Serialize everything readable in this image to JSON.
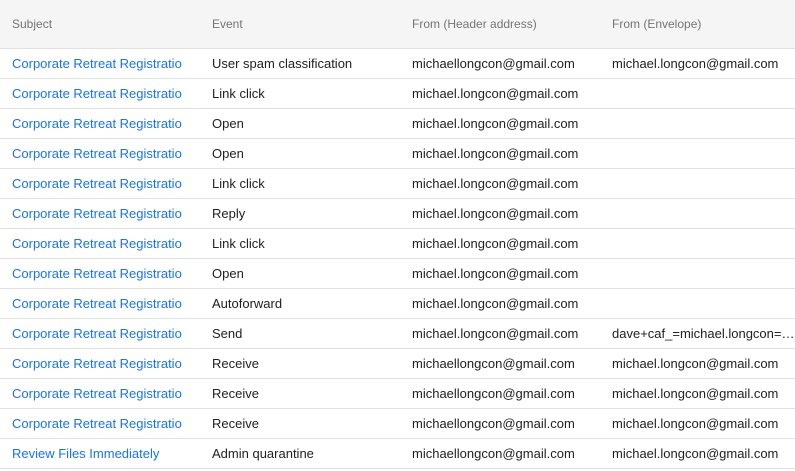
{
  "columns": {
    "subject": "Subject",
    "event": "Event",
    "from_header": "From (Header address)",
    "from_envelope": "From (Envelope)"
  },
  "rows": [
    {
      "subject": "Corporate Retreat Registratio",
      "event": "User spam classification",
      "from_header": "michaellongcon@gmail.com",
      "from_envelope": "michael.longcon@gmail.com"
    },
    {
      "subject": "Corporate Retreat Registratio",
      "event": "Link click",
      "from_header": "michael.longcon@gmail.com",
      "from_envelope": ""
    },
    {
      "subject": "Corporate Retreat Registratio",
      "event": "Open",
      "from_header": "michael.longcon@gmail.com",
      "from_envelope": ""
    },
    {
      "subject": "Corporate Retreat Registratio",
      "event": "Open",
      "from_header": "michael.longcon@gmail.com",
      "from_envelope": ""
    },
    {
      "subject": "Corporate Retreat Registratio",
      "event": "Link click",
      "from_header": "michael.longcon@gmail.com",
      "from_envelope": ""
    },
    {
      "subject": "Corporate Retreat Registratio",
      "event": "Reply",
      "from_header": "michael.longcon@gmail.com",
      "from_envelope": ""
    },
    {
      "subject": "Corporate Retreat Registratio",
      "event": "Link click",
      "from_header": "michael.longcon@gmail.com",
      "from_envelope": ""
    },
    {
      "subject": "Corporate Retreat Registratio",
      "event": "Open",
      "from_header": "michael.longcon@gmail.com",
      "from_envelope": ""
    },
    {
      "subject": "Corporate Retreat Registratio",
      "event": "Autoforward",
      "from_header": "michael.longcon@gmail.com",
      "from_envelope": ""
    },
    {
      "subject": "Corporate Retreat Registratio",
      "event": "Send",
      "from_header": "michael.longcon@gmail.com",
      "from_envelope": "dave+caf_=michael.longcon=gmail.com"
    },
    {
      "subject": "Corporate Retreat Registratio",
      "event": "Receive",
      "from_header": "michaellongcon@gmail.com",
      "from_envelope": "michael.longcon@gmail.com"
    },
    {
      "subject": "Corporate Retreat Registratio",
      "event": "Receive",
      "from_header": "michaellongcon@gmail.com",
      "from_envelope": "michael.longcon@gmail.com"
    },
    {
      "subject": "Corporate Retreat Registratio",
      "event": "Receive",
      "from_header": "michaellongcon@gmail.com",
      "from_envelope": "michael.longcon@gmail.com"
    },
    {
      "subject": "Review Files Immediately",
      "event": "Admin quarantine",
      "from_header": "michaellongcon@gmail.com",
      "from_envelope": "michael.longcon@gmail.com"
    }
  ]
}
